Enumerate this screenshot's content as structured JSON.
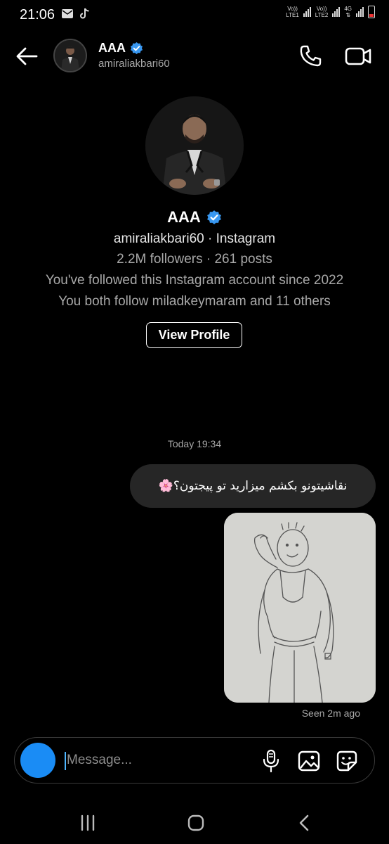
{
  "status_bar": {
    "time": "21:06",
    "sim1_top": "Vo))",
    "sim1_bottom": "LTE1",
    "sim2_top": "Vo))",
    "sim2_bottom": "LTE2",
    "network": "4G",
    "icons": [
      "mail-icon",
      "tiktok-icon",
      "signal-icon",
      "battery-icon"
    ]
  },
  "header": {
    "name": "AAA",
    "username": "amiraliakbari60",
    "icons": [
      "back-arrow-icon",
      "phone-icon",
      "video-camera-icon",
      "verified-badge-icon"
    ]
  },
  "profile": {
    "name": "AAA",
    "sub": "amiraliakbari60 · Instagram",
    "stats": "2.2M followers · 261 posts",
    "since": "You've followed this Instagram account since 2022",
    "mutual": "You both follow miladkeymaram and 11 others",
    "view_profile_label": "View Profile"
  },
  "chat": {
    "timestamp": "Today 19:34",
    "message_text": "نقاشیتونو بکشم میزارید تو پیجتون؟🌸",
    "seen": "Seen 2m ago"
  },
  "composer": {
    "placeholder": "Message...",
    "icons": [
      "camera-icon",
      "microphone-icon",
      "gallery-icon",
      "sticker-icon"
    ]
  },
  "navbar": {
    "icons": [
      "recents-icon",
      "home-icon",
      "back-icon"
    ]
  },
  "colors": {
    "background": "#000000",
    "bubble": "#262626",
    "accent_blue": "#1a8cf5",
    "secondary_text": "#a8a8a8"
  }
}
